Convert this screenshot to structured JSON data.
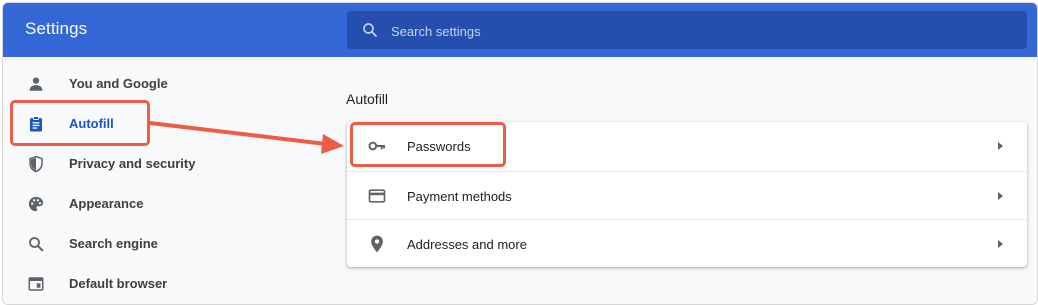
{
  "app": {
    "title": "Settings"
  },
  "search": {
    "placeholder": "Search settings",
    "icon": "search-icon"
  },
  "sidebar": {
    "items": [
      {
        "label": "You and Google",
        "icon": "person-icon",
        "active": false
      },
      {
        "label": "Autofill",
        "icon": "clipboard-icon",
        "active": true
      },
      {
        "label": "Privacy and security",
        "icon": "shield-icon",
        "active": false
      },
      {
        "label": "Appearance",
        "icon": "palette-icon",
        "active": false
      },
      {
        "label": "Search engine",
        "icon": "search-icon",
        "active": false
      },
      {
        "label": "Default browser",
        "icon": "browser-window-icon",
        "active": false
      }
    ]
  },
  "main": {
    "section_title": "Autofill",
    "rows": [
      {
        "label": "Passwords",
        "icon": "key-icon"
      },
      {
        "label": "Payment methods",
        "icon": "credit-card-icon"
      },
      {
        "label": "Addresses and more",
        "icon": "location-pin-icon"
      }
    ]
  },
  "colors": {
    "header": "#3367d6",
    "search_bg": "#254fae",
    "active_nav": "#1a56c9",
    "annotation": "#ec5d46"
  }
}
